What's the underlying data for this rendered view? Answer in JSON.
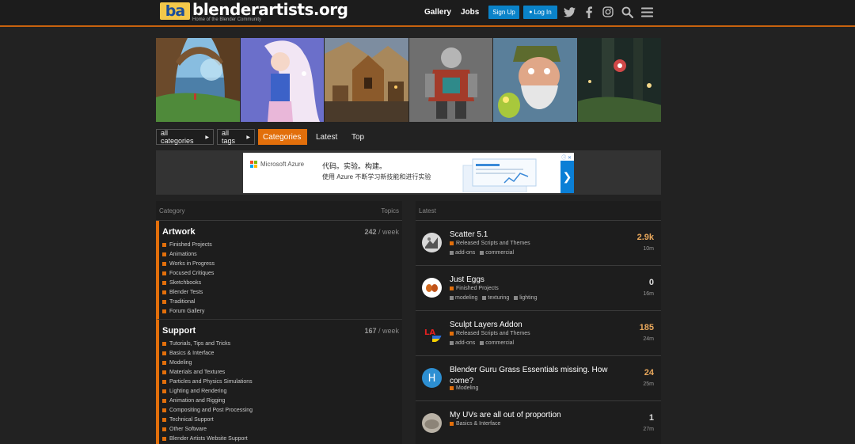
{
  "header": {
    "logo_badge": "ba",
    "logo_name": "blenderartists.org",
    "logo_tagline": "Home of the Blender Community",
    "nav": [
      "Gallery",
      "Jobs"
    ],
    "signup_label": "Sign Up",
    "login_label": "Log In",
    "icons": [
      "twitter-icon",
      "facebook-icon",
      "instagram-icon",
      "search-icon",
      "hamburger-menu-icon"
    ]
  },
  "banner": {
    "thumbs": [
      "forest-arch-artwork",
      "fantasy-girl-artwork",
      "medieval-town-artwork",
      "armored-warrior-artwork",
      "old-man-gecko-artwork",
      "forest-scene-artwork"
    ]
  },
  "filters": {
    "categories_dd": "all categories",
    "tags_dd": "all tags",
    "tabs": [
      "Categories",
      "Latest",
      "Top"
    ],
    "active_tab": "Categories"
  },
  "ad": {
    "brand": "Microsoft Azure",
    "line1": "代码。实验。构建。",
    "line2": "使用 Azure 不断学习新技能和进行实验",
    "choices": "ⓘ ✕"
  },
  "categories": {
    "header_category": "Category",
    "header_topics": "Topics",
    "items": [
      {
        "title": "Artwork",
        "count": "242",
        "per": "/ week",
        "subs": [
          "Finished Projects",
          "Animations",
          "Works in Progress",
          "Focused Critiques",
          "Sketchbooks",
          "Blender Tests",
          "Traditional",
          "Forum Gallery"
        ]
      },
      {
        "title": "Support",
        "count": "167",
        "per": "/ week",
        "subs": [
          "Tutorials, Tips and Tricks",
          "Basics & Interface",
          "Modeling",
          "Materials and Textures",
          "Particles and Physics Simulations",
          "Lighting and Rendering",
          "Animation and Rigging",
          "Compositing and Post Processing",
          "Technical Support",
          "Other Software",
          "Blender Artists Website Support"
        ]
      }
    ]
  },
  "latest": {
    "header": "Latest",
    "topics": [
      {
        "title": "Scatter 5.1",
        "category": "Released Scripts and Themes",
        "tags": [
          "add-ons",
          "commercial"
        ],
        "replies": "2.9k",
        "age": "10m",
        "hot": true
      },
      {
        "title": "Just Eggs",
        "category": "Finished Projects",
        "tags": [
          "modeling",
          "texturing",
          "lighting"
        ],
        "replies": "0",
        "age": "16m",
        "hot": false
      },
      {
        "title": "Sculpt Layers Addon",
        "category": "Released Scripts and Themes",
        "tags": [
          "add-ons",
          "commercial"
        ],
        "replies": "185",
        "age": "24m",
        "hot": true
      },
      {
        "title": "Blender Guru Grass Essentials missing. How come?",
        "category": "Modeling",
        "tags": [],
        "replies": "24",
        "age": "25m",
        "hot": true,
        "avatar_letter": "H"
      },
      {
        "title": "My UVs are all out of proportion",
        "category": "Basics & Interface",
        "tags": [],
        "replies": "1",
        "age": "27m",
        "hot": false
      }
    ]
  },
  "colors": {
    "accent": "#e26f0b",
    "blue": "#0a83c9",
    "hot_reply": "#e9a85c"
  }
}
